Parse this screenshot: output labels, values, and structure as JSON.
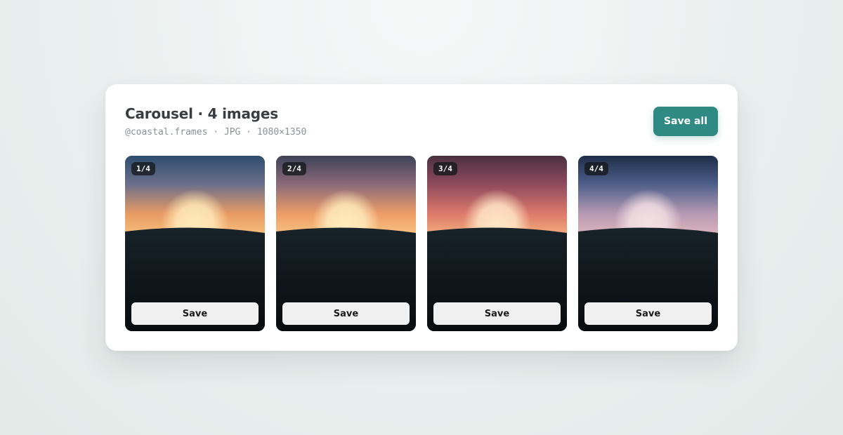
{
  "header": {
    "title": "Carousel · 4 images",
    "meta": "@coastal.frames · JPG · 1080×1350",
    "save_all_label": "Save all"
  },
  "images": [
    {
      "index_label": "1/4",
      "save_label": "Save",
      "sky": [
        "#2d4d6e",
        "#6b6f8c",
        "#e89a63",
        "#f7c27e"
      ],
      "sun": "#ffe9b8"
    },
    {
      "index_label": "2/4",
      "save_label": "Save",
      "sky": [
        "#3f4257",
        "#8a6a7a",
        "#ee9d67",
        "#f8c583"
      ],
      "sun": "#ffebbd"
    },
    {
      "index_label": "3/4",
      "save_label": "Save",
      "sky": [
        "#4a3140",
        "#8e4a5e",
        "#dd7a6a",
        "#f4b07d"
      ],
      "sun": "#ffe6c6"
    },
    {
      "index_label": "4/4",
      "save_label": "Save",
      "sky": [
        "#1f2d48",
        "#4d5f8a",
        "#b79ab3",
        "#e0b6bc"
      ],
      "sun": "#f3dfe3"
    }
  ],
  "colors": {
    "accent": "#2e8a82",
    "ground": "#172229"
  }
}
